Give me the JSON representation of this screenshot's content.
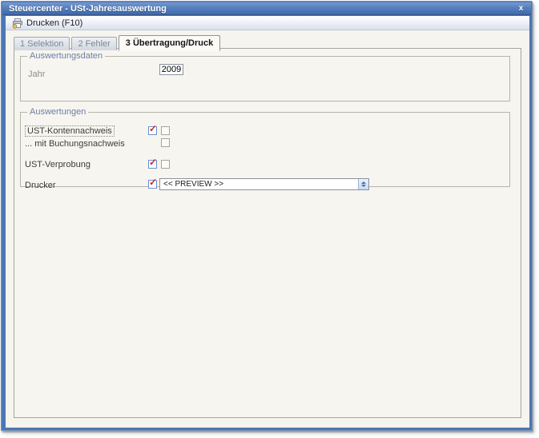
{
  "window": {
    "title": "Steuercenter - USt-Jahresauswertung",
    "close_glyph": "x"
  },
  "toolbar": {
    "print_label": "Drucken (F10)"
  },
  "tabs": [
    {
      "label": "1 Selektion",
      "active": false
    },
    {
      "label": "2 Fehler",
      "active": false
    },
    {
      "label": "3 Übertragung/Druck",
      "active": true
    }
  ],
  "auswertungsdaten": {
    "title": "Auswertungsdaten",
    "jahr_label": "Jahr",
    "jahr_value": "2009"
  },
  "auswertungen": {
    "title": "Auswertungen",
    "kontennachweis_label": "UST-Kontennachweis",
    "buchungsnachweis_label": "... mit Buchungsnachweis",
    "verprobung_label": "UST-Verprobung",
    "drucker_label": "Drucker",
    "drucker_value": "<< PREVIEW >>"
  },
  "glyphs": {
    "check": "✓"
  },
  "colors": {
    "frame_blue": "#4c77b5",
    "titlebar_gradient_top": "#7897cf",
    "titlebar_gradient_bottom": "#416aab",
    "groupbox_label_blue": "#6b7ea3",
    "check_red": "#c52b3a",
    "content_background": "#f6f4ef",
    "tab_inactive_text": "#7e8899"
  }
}
